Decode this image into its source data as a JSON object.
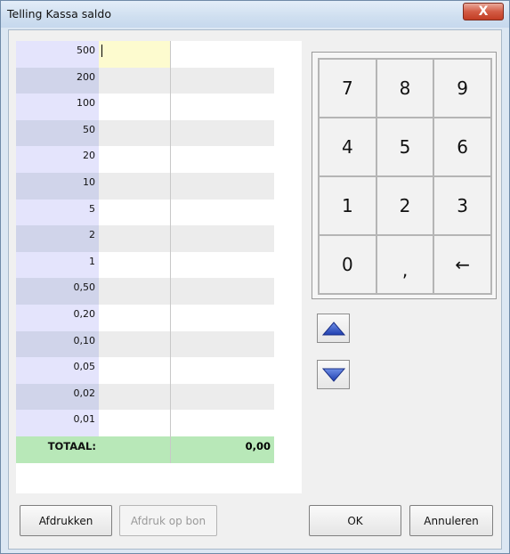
{
  "window": {
    "title": "Telling Kassa saldo",
    "close_glyph": "X"
  },
  "grid": {
    "denominations": [
      "500",
      "200",
      "100",
      "50",
      "20",
      "10",
      "5",
      "2",
      "1",
      "0,50",
      "0,20",
      "0,10",
      "0,05",
      "0,02",
      "0,01"
    ],
    "total_label": "TOTAAL:",
    "total_value": "0,00"
  },
  "numpad": {
    "keys": [
      "7",
      "8",
      "9",
      "4",
      "5",
      "6",
      "1",
      "2",
      "3",
      "0",
      ",",
      "←"
    ]
  },
  "buttons": {
    "print": "Afdrukken",
    "print_receipt": "Afdruk op bon",
    "ok": "OK",
    "cancel": "Annuleren"
  },
  "colors": {
    "accent_blue": "#2a4fb8",
    "total_row": "#b8e8b8",
    "active_cell": "#fdfbcf"
  },
  "icons": {
    "up": "triangle-up-icon",
    "down": "triangle-down-icon",
    "backspace": "left-arrow-icon"
  }
}
